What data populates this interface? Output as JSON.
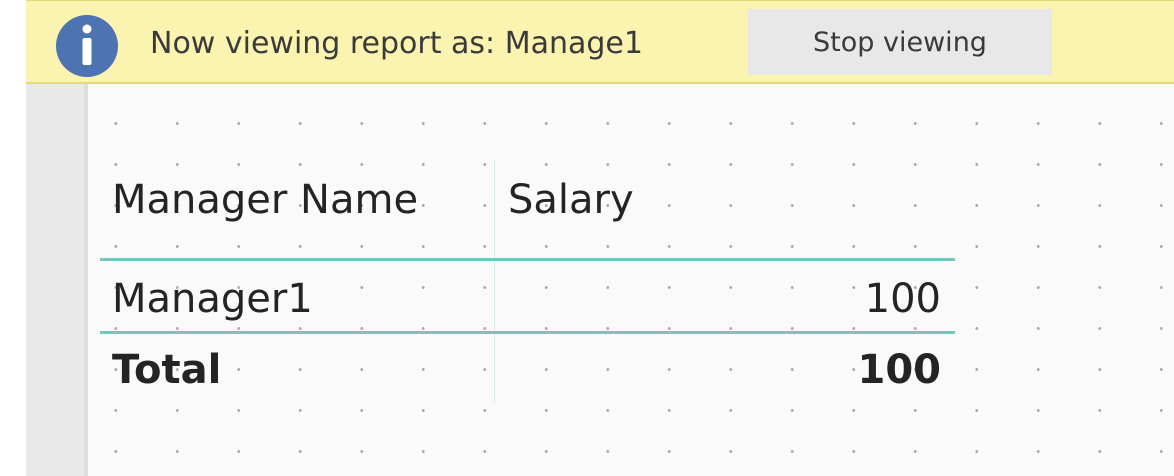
{
  "banner": {
    "message": "Now viewing report as: Manage1",
    "stop_button_label": "Stop viewing",
    "icon": "info-icon",
    "background_color": "#fbf3b0",
    "icon_color": "#4d73b1"
  },
  "table": {
    "columns": [
      "Manager Name",
      "Salary"
    ],
    "rows": [
      {
        "name": "Manager1",
        "salary": "100"
      }
    ],
    "total": {
      "label": "Total",
      "value": "100"
    },
    "accent_color": "#74c7bd"
  }
}
